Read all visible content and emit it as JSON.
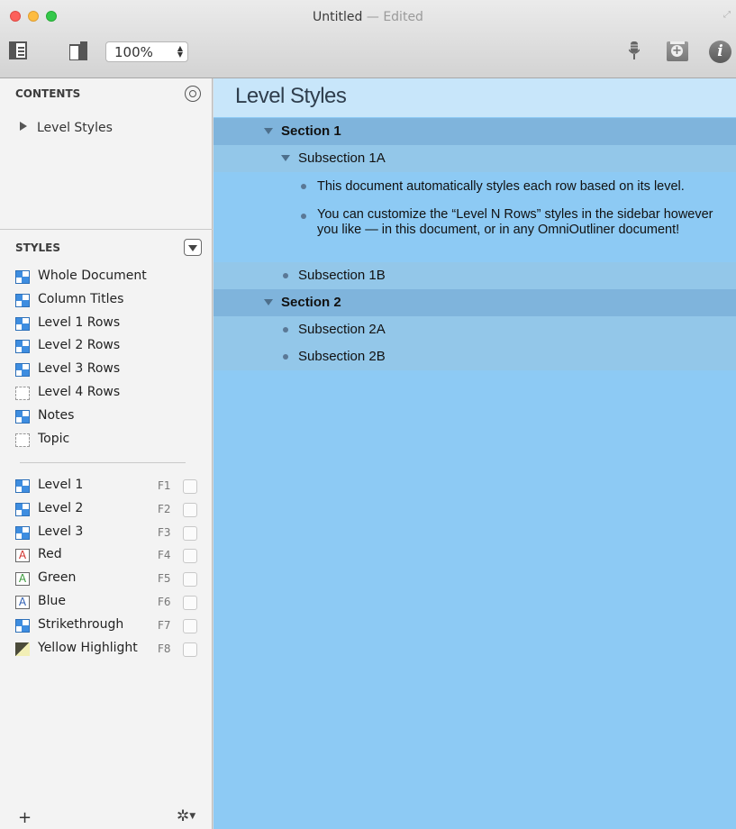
{
  "window": {
    "title": "Untitled",
    "title_sep": " — ",
    "edited_label": "Edited"
  },
  "toolbar": {
    "zoom_value": "100%"
  },
  "sidebar": {
    "contents_heading": "CONTENTS",
    "contents_items": [
      "Level Styles"
    ],
    "styles_heading": "STYLES",
    "document_styles": [
      {
        "label": "Whole Document",
        "icon": "blue"
      },
      {
        "label": "Column Titles",
        "icon": "blue"
      },
      {
        "label": "Level 1 Rows",
        "icon": "blue"
      },
      {
        "label": "Level 2 Rows",
        "icon": "blue"
      },
      {
        "label": "Level 3 Rows",
        "icon": "blue"
      },
      {
        "label": "Level 4 Rows",
        "icon": "dotted"
      },
      {
        "label": "Notes",
        "icon": "blue"
      },
      {
        "label": "Topic",
        "icon": "dotted"
      }
    ],
    "named_styles": [
      {
        "label": "Level 1",
        "key": "F1",
        "icon": "blue"
      },
      {
        "label": "Level 2",
        "key": "F2",
        "icon": "blue"
      },
      {
        "label": "Level 3",
        "key": "F3",
        "icon": "blue"
      },
      {
        "label": "Red",
        "key": "F4",
        "icon": "letter",
        "letter": "A",
        "letter_color": "#d0312d"
      },
      {
        "label": "Green",
        "key": "F5",
        "icon": "letter",
        "letter": "A",
        "letter_color": "#3a9a3a"
      },
      {
        "label": "Blue",
        "key": "F6",
        "icon": "letter",
        "letter": "A",
        "letter_color": "#2f5fb3"
      },
      {
        "label": "Strikethrough",
        "key": "F7",
        "icon": "blue"
      },
      {
        "label": "Yellow Highlight",
        "key": "F8",
        "icon": "highlight"
      }
    ],
    "add_label": "+"
  },
  "document": {
    "title": "Level Styles",
    "rows": [
      {
        "level": 1,
        "text": "Section 1",
        "marker": "triangle"
      },
      {
        "level": 2,
        "text": "Subsection 1A",
        "marker": "triangle"
      },
      {
        "level": 3,
        "text": "This document automatically styles each row based on its level.",
        "marker": "bullet"
      },
      {
        "level": 3,
        "text": "You can customize the “Level N Rows” styles in the sidebar however you like — in this document, or in any OmniOutliner document!",
        "marker": "bullet"
      },
      {
        "level": 2,
        "text": "Subsection 1B",
        "marker": "bullet"
      },
      {
        "level": 1,
        "text": "Section 2",
        "marker": "triangle"
      },
      {
        "level": 2,
        "text": "Subsection 2A",
        "marker": "bullet"
      },
      {
        "level": 2,
        "text": "Subsection 2B",
        "marker": "bullet"
      }
    ]
  },
  "colors": {
    "doc_background": "#8dcaf4",
    "title_bar": "#c8e6fa",
    "level1_row": "#7fb4dc",
    "level2_row": "#93c7e9"
  }
}
